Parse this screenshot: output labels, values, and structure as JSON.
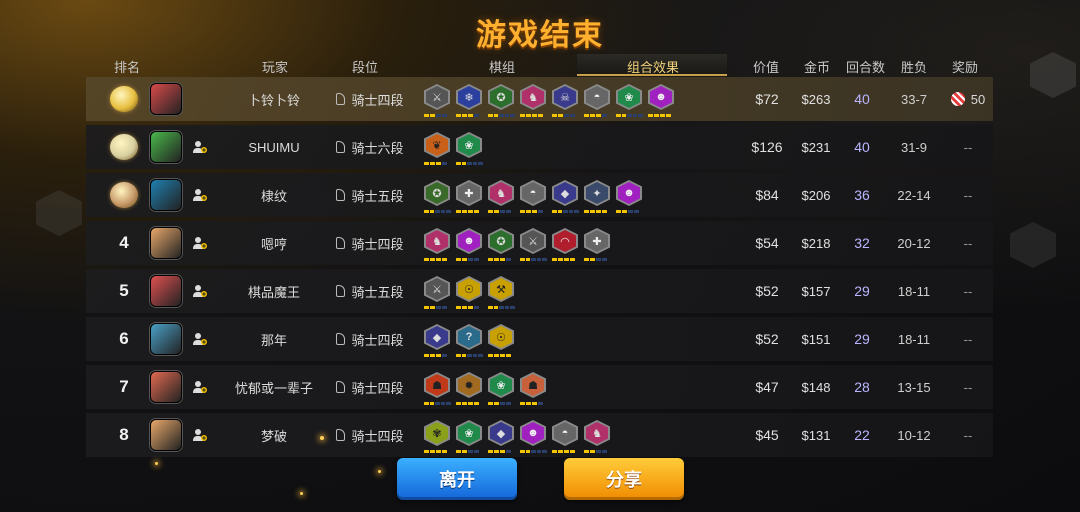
{
  "title": "游戏结束",
  "headers": {
    "rank": "排名",
    "player": "玩家",
    "tier": "段位",
    "pieces": "棋组",
    "synergy": "组合效果",
    "value": "价值",
    "gold": "金币",
    "rounds": "回合数",
    "wl": "胜负",
    "reward": "奖励"
  },
  "rows": [
    {
      "rank": "",
      "avatar_color": "#d94a4a",
      "player": "卜铃卜铃",
      "tier": "骑士四段",
      "value": "$72",
      "gold": "$263",
      "rounds": "40",
      "wl": "33-7",
      "reward": "50",
      "synergies": [
        {
          "color": "#555",
          "fg": "#ddd",
          "glyph": "⚔"
        },
        {
          "color": "#2b3f9e",
          "fg": "#ddd",
          "glyph": "❄"
        },
        {
          "color": "#2c6e2c",
          "fg": "#ddd",
          "glyph": "✪"
        },
        {
          "color": "#b0306a",
          "fg": "#ddd",
          "glyph": "♞"
        },
        {
          "color": "#3a3a8c",
          "fg": "#ddd",
          "glyph": "☠"
        },
        {
          "color": "#666",
          "fg": "#eee",
          "glyph": "◓"
        },
        {
          "color": "#1f8a4a",
          "fg": "#eee",
          "glyph": "❀"
        },
        {
          "color": "#a020c0",
          "fg": "#eee",
          "glyph": "☻"
        }
      ]
    },
    {
      "rank": "",
      "avatar_color": "#4bb84b",
      "player": "SHUIMU",
      "tier": "骑士六段",
      "value": "$126",
      "gold": "$231",
      "rounds": "40",
      "wl": "31-9",
      "reward": "--",
      "synergies": [
        {
          "color": "#c8601a",
          "fg": "#222",
          "glyph": "❦"
        },
        {
          "color": "#1f8a4a",
          "fg": "#eee",
          "glyph": "❀"
        }
      ]
    },
    {
      "rank": "",
      "avatar_color": "#1f7fb0",
      "player": "棣纹",
      "tier": "骑士五段",
      "value": "$84",
      "gold": "$206",
      "rounds": "36",
      "wl": "22-14",
      "reward": "--",
      "synergies": [
        {
          "color": "#3a6a2a",
          "fg": "#ddd",
          "glyph": "✪"
        },
        {
          "color": "#666",
          "fg": "#eee",
          "glyph": "✚"
        },
        {
          "color": "#b0306a",
          "fg": "#ddd",
          "glyph": "♞"
        },
        {
          "color": "#666",
          "fg": "#eee",
          "glyph": "◓"
        },
        {
          "color": "#3a3a8c",
          "fg": "#ddd",
          "glyph": "◆"
        },
        {
          "color": "#3a4a6a",
          "fg": "#ddd",
          "glyph": "✦"
        },
        {
          "color": "#a020c0",
          "fg": "#eee",
          "glyph": "☻"
        }
      ]
    },
    {
      "rank": "4",
      "avatar_color": "#e8a86a",
      "player": "嗯哼",
      "tier": "骑士四段",
      "value": "$54",
      "gold": "$218",
      "rounds": "32",
      "wl": "20-12",
      "reward": "--",
      "synergies": [
        {
          "color": "#b0306a",
          "fg": "#ddd",
          "glyph": "♞"
        },
        {
          "color": "#a020c0",
          "fg": "#eee",
          "glyph": "☻"
        },
        {
          "color": "#2c6e2c",
          "fg": "#ddd",
          "glyph": "✪"
        },
        {
          "color": "#555",
          "fg": "#ddd",
          "glyph": "⚔"
        },
        {
          "color": "#b01e2e",
          "fg": "#eee",
          "glyph": "◠"
        },
        {
          "color": "#666",
          "fg": "#eee",
          "glyph": "✚"
        }
      ]
    },
    {
      "rank": "5",
      "avatar_color": "#e05050",
      "player": "棋品魔王",
      "tier": "骑士五段",
      "value": "$52",
      "gold": "$157",
      "rounds": "29",
      "wl": "18-11",
      "reward": "--",
      "synergies": [
        {
          "color": "#555",
          "fg": "#ddd",
          "glyph": "⚔"
        },
        {
          "color": "#c8a000",
          "fg": "#222",
          "glyph": "☉"
        },
        {
          "color": "#c8a000",
          "fg": "#222",
          "glyph": "⚒"
        }
      ]
    },
    {
      "rank": "6",
      "avatar_color": "#4aa0c8",
      "player": "那年",
      "tier": "骑士四段",
      "value": "$52",
      "gold": "$151",
      "rounds": "29",
      "wl": "18-11",
      "reward": "--",
      "synergies": [
        {
          "color": "#3a3a8c",
          "fg": "#ddd",
          "glyph": "◆"
        },
        {
          "color": "#2a6a8a",
          "fg": "#ddd",
          "glyph": "?"
        },
        {
          "color": "#c8a000",
          "fg": "#222",
          "glyph": "☉"
        }
      ]
    },
    {
      "rank": "7",
      "avatar_color": "#e06a50",
      "player": "忧郁或一辈子",
      "tier": "骑士四段",
      "value": "$47",
      "gold": "$148",
      "rounds": "28",
      "wl": "13-15",
      "reward": "--",
      "synergies": [
        {
          "color": "#c03a1a",
          "fg": "#222",
          "glyph": "☗"
        },
        {
          "color": "#a06a20",
          "fg": "#222",
          "glyph": "✹"
        },
        {
          "color": "#1f8a4a",
          "fg": "#eee",
          "glyph": "❀"
        },
        {
          "color": "#c8603a",
          "fg": "#222",
          "glyph": "☗"
        }
      ]
    },
    {
      "rank": "8",
      "avatar_color": "#e8a86a",
      "player": "梦破",
      "tier": "骑士四段",
      "value": "$45",
      "gold": "$131",
      "rounds": "22",
      "wl": "10-12",
      "reward": "--",
      "synergies": [
        {
          "color": "#8aa01a",
          "fg": "#222",
          "glyph": "✾"
        },
        {
          "color": "#1f8a4a",
          "fg": "#eee",
          "glyph": "❀"
        },
        {
          "color": "#3a3a8c",
          "fg": "#ddd",
          "glyph": "◆"
        },
        {
          "color": "#a020c0",
          "fg": "#eee",
          "glyph": "☻"
        },
        {
          "color": "#666",
          "fg": "#eee",
          "glyph": "◓"
        },
        {
          "color": "#b0306a",
          "fg": "#ddd",
          "glyph": "♞"
        }
      ]
    }
  ],
  "buttons": {
    "leave": "离开",
    "share": "分享"
  },
  "colors": {
    "accent": "#ffb02e",
    "leave": "#1e7ee8",
    "share": "#f5a000",
    "rounds": "#b9b6ff"
  }
}
